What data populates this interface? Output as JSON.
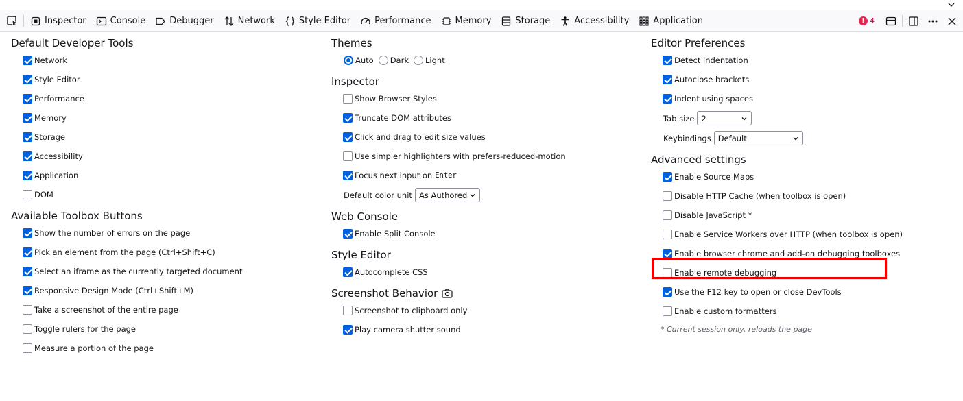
{
  "toolbar": {
    "tabs": [
      {
        "label": "Inspector",
        "icon": "inspector-icon"
      },
      {
        "label": "Console",
        "icon": "console-icon"
      },
      {
        "label": "Debugger",
        "icon": "debugger-icon"
      },
      {
        "label": "Network",
        "icon": "network-icon"
      },
      {
        "label": "Style Editor",
        "icon": "style-editor-icon"
      },
      {
        "label": "Performance",
        "icon": "performance-icon"
      },
      {
        "label": "Memory",
        "icon": "memory-icon"
      },
      {
        "label": "Storage",
        "icon": "storage-icon"
      },
      {
        "label": "Accessibility",
        "icon": "accessibility-icon"
      },
      {
        "label": "Application",
        "icon": "application-icon"
      }
    ],
    "error_count": "4"
  },
  "col1": {
    "default_tools": {
      "title": "Default Developer Tools",
      "items": [
        {
          "label": "Network",
          "checked": true
        },
        {
          "label": "Style Editor",
          "checked": true
        },
        {
          "label": "Performance",
          "checked": true
        },
        {
          "label": "Memory",
          "checked": true
        },
        {
          "label": "Storage",
          "checked": true
        },
        {
          "label": "Accessibility",
          "checked": true
        },
        {
          "label": "Application",
          "checked": true
        },
        {
          "label": "DOM",
          "checked": false
        }
      ]
    },
    "toolbox_buttons": {
      "title": "Available Toolbox Buttons",
      "items": [
        {
          "label": "Show the number of errors on the page",
          "checked": true
        },
        {
          "label": "Pick an element from the page (Ctrl+Shift+C)",
          "checked": true
        },
        {
          "label": "Select an iframe as the currently targeted document",
          "checked": true
        },
        {
          "label": "Responsive Design Mode (Ctrl+Shift+M)",
          "checked": true
        },
        {
          "label": "Take a screenshot of the entire page",
          "checked": false
        },
        {
          "label": "Toggle rulers for the page",
          "checked": false
        },
        {
          "label": "Measure a portion of the page",
          "checked": false
        }
      ]
    }
  },
  "col2": {
    "themes": {
      "title": "Themes",
      "options": [
        {
          "label": "Auto",
          "selected": true
        },
        {
          "label": "Dark",
          "selected": false
        },
        {
          "label": "Light",
          "selected": false
        }
      ]
    },
    "inspector": {
      "title": "Inspector",
      "items": [
        {
          "label": "Show Browser Styles",
          "checked": false
        },
        {
          "label": "Truncate DOM attributes",
          "checked": true
        },
        {
          "label": "Click and drag to edit size values",
          "checked": true
        },
        {
          "label": "Use simpler highlighters with prefers-reduced-motion",
          "checked": false
        }
      ],
      "focus_label": "Focus next input on",
      "focus_key": "Enter",
      "focus_checked": true,
      "color_unit_label": "Default color unit",
      "color_unit_value": "As Authored"
    },
    "web_console": {
      "title": "Web Console",
      "items": [
        {
          "label": "Enable Split Console",
          "checked": true
        }
      ]
    },
    "style_editor": {
      "title": "Style Editor",
      "items": [
        {
          "label": "Autocomplete CSS",
          "checked": true
        }
      ]
    },
    "screenshot": {
      "title": "Screenshot Behavior",
      "items": [
        {
          "label": "Screenshot to clipboard only",
          "checked": false
        },
        {
          "label": "Play camera shutter sound",
          "checked": true
        }
      ]
    }
  },
  "col3": {
    "editor": {
      "title": "Editor Preferences",
      "items": [
        {
          "label": "Detect indentation",
          "checked": true
        },
        {
          "label": "Autoclose brackets",
          "checked": true
        },
        {
          "label": "Indent using spaces",
          "checked": true
        }
      ],
      "tab_size_label": "Tab size",
      "tab_size_value": "2",
      "keybindings_label": "Keybindings",
      "keybindings_value": "Default"
    },
    "advanced": {
      "title": "Advanced settings",
      "items": [
        {
          "label": "Enable Source Maps",
          "checked": true
        },
        {
          "label": "Disable HTTP Cache (when toolbox is open)",
          "checked": false
        },
        {
          "label": "Disable JavaScript *",
          "checked": false
        },
        {
          "label": "Enable Service Workers over HTTP (when toolbox is open)",
          "checked": false
        },
        {
          "label": "Enable browser chrome and add-on debugging toolboxes",
          "checked": true
        },
        {
          "label": "Enable remote debugging",
          "checked": false
        },
        {
          "label": "Use the F12 key to open or close DevTools",
          "checked": true
        },
        {
          "label": "Enable custom formatters",
          "checked": false
        }
      ],
      "note": "* Current session only, reloads the page"
    }
  },
  "colors": {
    "accent": "#0061e0",
    "highlight": "#ee0000",
    "error": "#e22850"
  }
}
